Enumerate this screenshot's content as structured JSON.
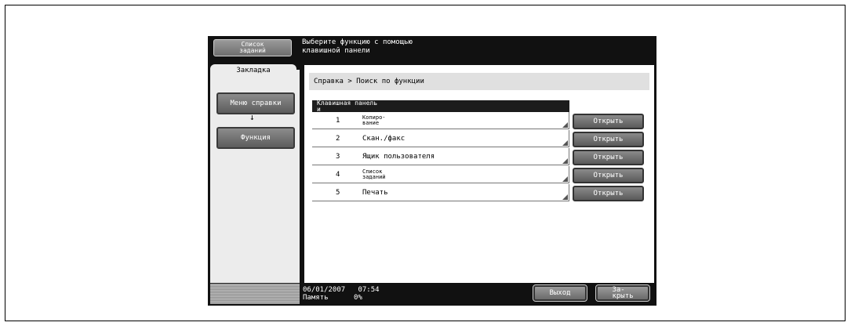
{
  "header": {
    "job_list_button": "Список\nзаданий",
    "message": "Выберите функцию с помощью\nклавишной панели"
  },
  "sidebar": {
    "tab_label": "Закладка",
    "help_menu_button": "Меню справки",
    "arrow": "↓",
    "function_button": "Функция"
  },
  "breadcrumb": {
    "root": "Справка",
    "separator": ">",
    "current": "Поиск по функции"
  },
  "list": {
    "header": "Клавишная панель\nи",
    "items": [
      {
        "num": "1",
        "label": "Копиро-\nвание",
        "open": "Открыть"
      },
      {
        "num": "2",
        "label": "Скан./факс",
        "open": "Открыть"
      },
      {
        "num": "3",
        "label": "Ящик пользователя",
        "open": "Открыть"
      },
      {
        "num": "4",
        "label": "Список\nзаданий",
        "open": "Открыть"
      },
      {
        "num": "5",
        "label": "Печать",
        "open": "Открыть"
      }
    ]
  },
  "status": {
    "date": "06/01/2007",
    "time": "07:54",
    "memory_label": "Память",
    "memory_value": "0%"
  },
  "footer": {
    "exit_button": "Выход",
    "close_button": "За-\nкрыть"
  }
}
